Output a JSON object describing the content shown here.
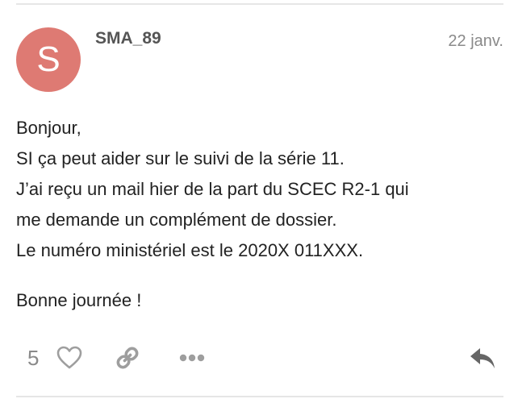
{
  "post": {
    "avatar_letter": "S",
    "avatar_color": "#de7a73",
    "username": "SMA_89",
    "date": "22 janv.",
    "body_lines": [
      "Bonjour,",
      "SI ça peut aider sur le suivi de la série 11.",
      "J’ai reçu un mail hier de la part du SCEC R2-1 qui",
      "me demande un complément de dossier.",
      "Le numéro ministériel est le 2020X 011XXX."
    ],
    "closing": "Bonne journée !"
  },
  "actions": {
    "like_count": "5",
    "icons": [
      "heart-icon",
      "link-icon",
      "more-icon",
      "reply-icon"
    ],
    "icon_color": "#9e9e9e",
    "reply_color": "#666666"
  }
}
